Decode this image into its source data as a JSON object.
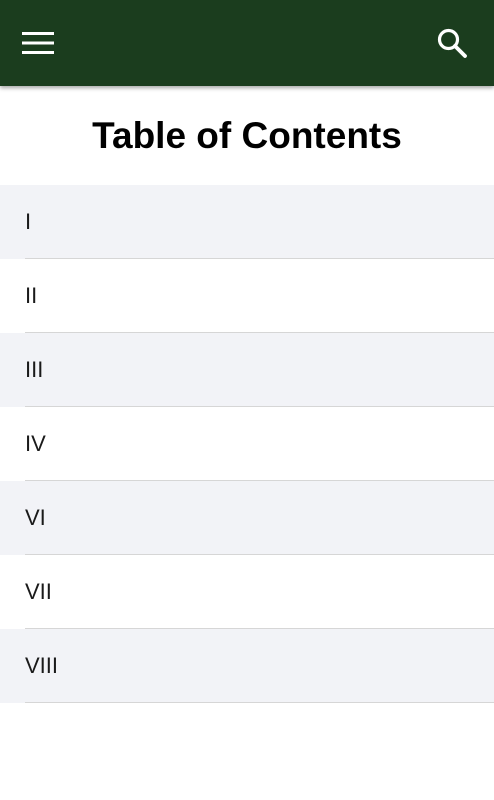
{
  "app_bar": {
    "background": "#1b3d1e",
    "menu_icon": "hamburger-menu-icon",
    "search_icon": "search-icon"
  },
  "page": {
    "title": "Table of Contents"
  },
  "toc": {
    "items": [
      {
        "label": "I"
      },
      {
        "label": "II"
      },
      {
        "label": "III"
      },
      {
        "label": "IV"
      },
      {
        "label": "VI"
      },
      {
        "label": "VII"
      },
      {
        "label": "VIII"
      }
    ]
  }
}
